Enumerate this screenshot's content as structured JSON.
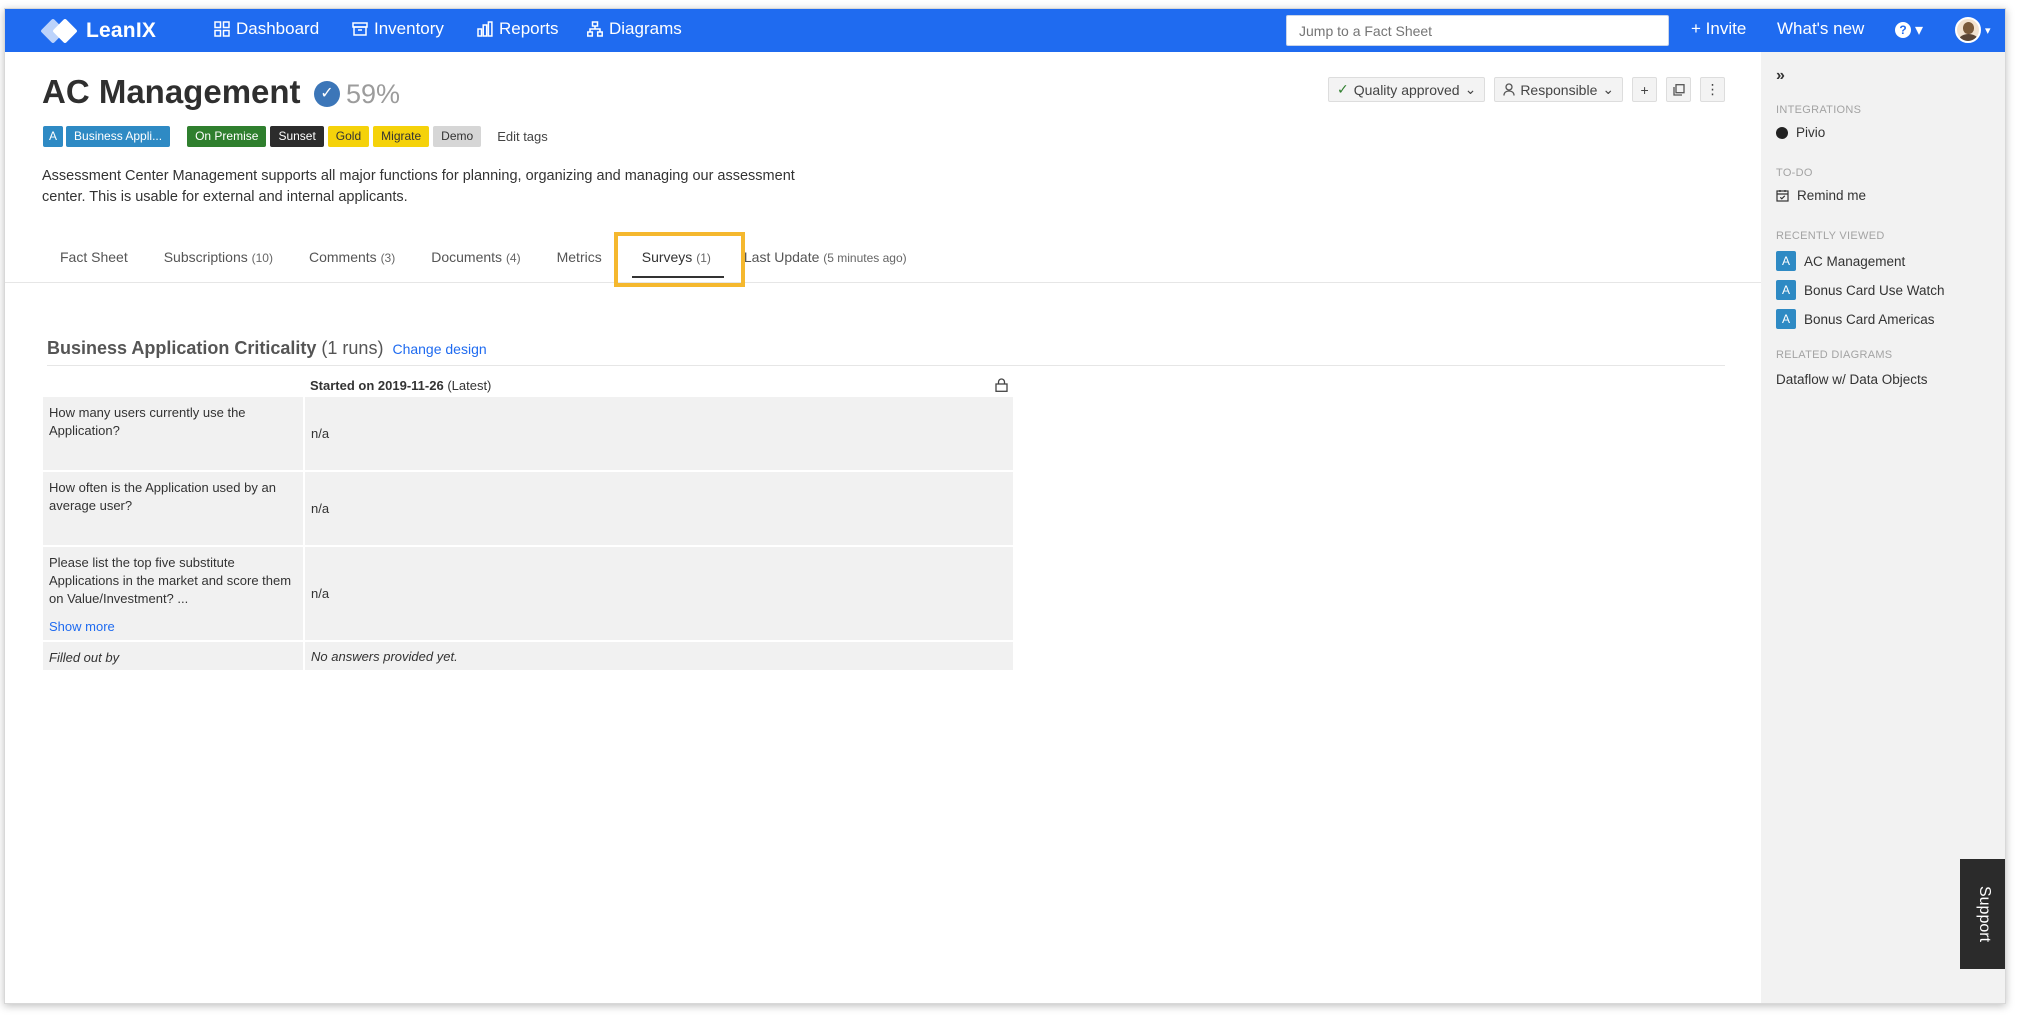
{
  "topbar": {
    "brand": "LeanIX",
    "nav": [
      {
        "label": "Dashboard",
        "icon": "dashboard-icon"
      },
      {
        "label": "Inventory",
        "icon": "inventory-icon"
      },
      {
        "label": "Reports",
        "icon": "reports-icon"
      },
      {
        "label": "Diagrams",
        "icon": "diagrams-icon"
      }
    ],
    "search_placeholder": "Jump to a Fact Sheet",
    "invite": "+ Invite",
    "whats_new": "What's new",
    "help_caret": "▾"
  },
  "factsheet": {
    "title": "AC Management",
    "completion": "59%",
    "type_letter": "A",
    "type_label": "Business Appli...",
    "tags": [
      "On Premise",
      "Sunset",
      "Gold",
      "Migrate",
      "Demo"
    ],
    "edit_tags": "Edit tags",
    "description": "Assessment Center Management supports all major functions for planning, organizing and managing our assessment center. This is usable for external and internal applicants.",
    "quality": "Quality approved",
    "responsible": "Responsible"
  },
  "tabs": [
    {
      "label": "Fact Sheet",
      "count": ""
    },
    {
      "label": "Subscriptions",
      "count": "(10)"
    },
    {
      "label": "Comments",
      "count": "(3)"
    },
    {
      "label": "Documents",
      "count": "(4)"
    },
    {
      "label": "Metrics",
      "count": ""
    },
    {
      "label": "Surveys",
      "count": "(1)"
    },
    {
      "label": "Last Update",
      "count": "(5 minutes ago)"
    }
  ],
  "active_tab": "Surveys",
  "survey": {
    "title": "Business Application Criticality",
    "runs": "(1 runs)",
    "change_design": "Change design",
    "started": "Started on 2019-11-26",
    "latest": "(Latest)",
    "questions": [
      {
        "q": "How many users currently use the Application?",
        "a": "n/a"
      },
      {
        "q": "How often is the Application used by an average user?",
        "a": "n/a"
      },
      {
        "q": "Please list the top five substitute Applications in the market and score them on Value/Investment? ...",
        "a": "n/a",
        "more": "Show more"
      }
    ],
    "filled_label": "Filled out by",
    "filled_value": "No answers provided yet."
  },
  "sidebar": {
    "collapse": "»",
    "integrations_h": "INTEGRATIONS",
    "integration": "Pivio",
    "todo_h": "TO-DO",
    "remind": "Remind me",
    "recent_h": "RECENTLY VIEWED",
    "recent": [
      {
        "letter": "A",
        "label": "AC Management"
      },
      {
        "letter": "A",
        "label": "Bonus Card Use Watch"
      },
      {
        "letter": "A",
        "label": "Bonus Card Americas"
      }
    ],
    "diagrams_h": "RELATED DIAGRAMS",
    "diagram": "Dataflow w/ Data Objects"
  },
  "support": "Support",
  "colors": {
    "brand": "#1f6bf0",
    "highlight": "#f5b82e",
    "type_badge": "#2e8ac4"
  }
}
